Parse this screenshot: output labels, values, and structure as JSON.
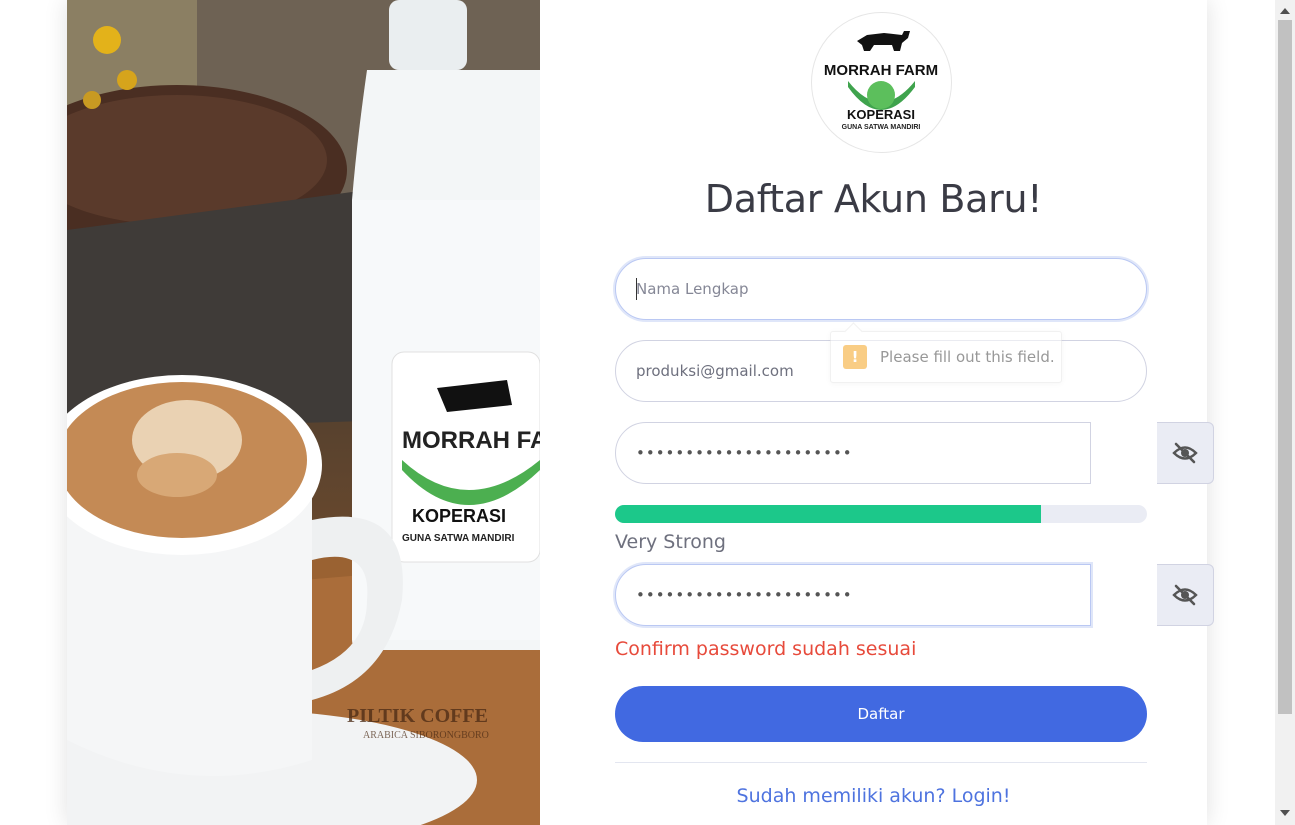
{
  "page": {
    "title": "Daftar Akun Baru!"
  },
  "logo": {
    "line1": "MORRAH FARM",
    "line2": "KOPERASI",
    "line3": "GUNA SATWA MANDIRI"
  },
  "photo": {
    "label_line1": "MORRAH FARM",
    "label_line2": "KOPERASI",
    "label_line3": "GUNA SATWA MANDIRI",
    "board_line1": "PILTIK COFFE",
    "board_line2": "ARABICA SIBORONGBORO"
  },
  "form": {
    "name_placeholder": "Nama Lengkap",
    "name_value": "",
    "email_value": "produksi@gmail.com",
    "password_mask": "••••••••••••••••••••••",
    "confirm_mask": "••••••••••••••••••••••",
    "strength_fraction": 0.8,
    "strength_label": "Very Strong",
    "confirm_message": "Confirm password sudah sesuai",
    "submit_label": "Daftar",
    "login_link": "Sudah memiliki akun? Login!"
  },
  "tooltip": {
    "icon": "!",
    "message": "Please fill out this field."
  },
  "colors": {
    "primary": "#4169e1",
    "success": "#1cc88a",
    "danger": "#e74a3b",
    "link": "#4e73df"
  },
  "icons": {
    "eye": "eye-slash-icon",
    "warning": "warning-icon"
  }
}
